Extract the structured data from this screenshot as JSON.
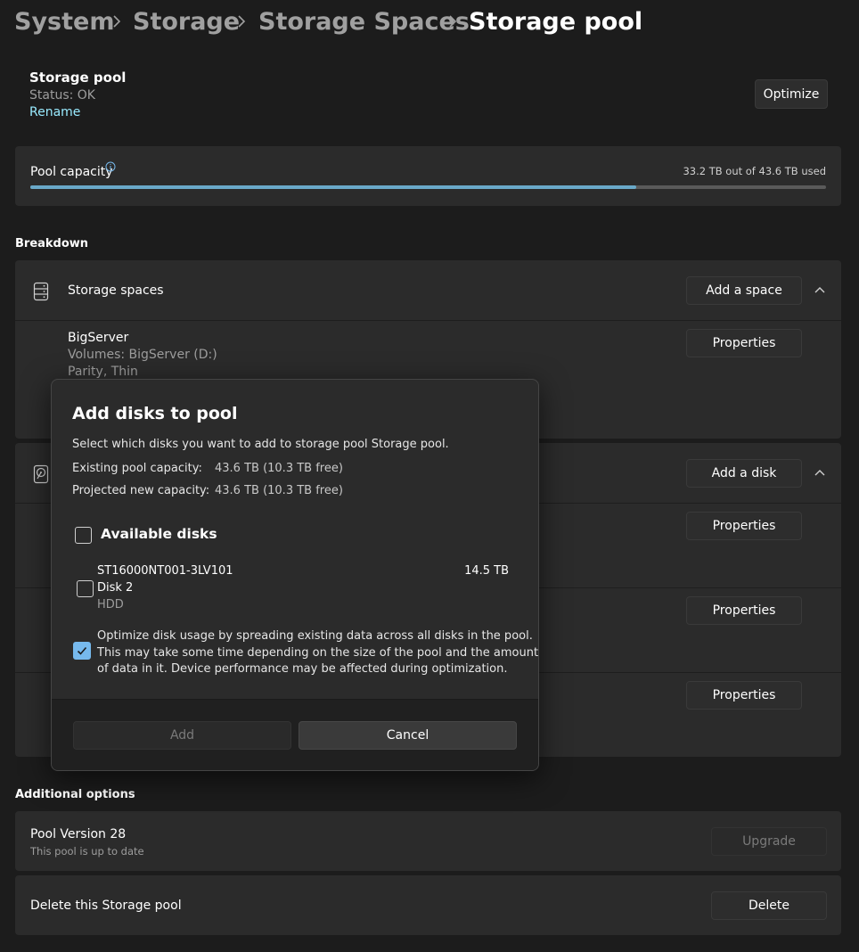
{
  "breadcrumb": {
    "items": [
      "System",
      "Storage",
      "Storage Spaces",
      "Storage pool"
    ]
  },
  "pool_header": {
    "title": "Storage pool",
    "status": "Status: OK",
    "rename": "Rename",
    "optimize_label": "Optimize"
  },
  "capacity": {
    "label": "Pool capacity",
    "usage_text": "33.2 TB out of 43.6 TB used",
    "used_fraction": 0.761
  },
  "breakdown": {
    "heading": "Breakdown",
    "storage_spaces": {
      "label": "Storage spaces",
      "add_label": "Add a space",
      "icon": "drive-stack-icon",
      "item": {
        "name": "BigServer",
        "volumes": "Volumes: BigServer (D:)",
        "type": "Parity, Thin",
        "properties_label": "Properties"
      }
    },
    "physical_disks": {
      "icon": "hard-disk-icon",
      "add_label": "Add a disk",
      "properties_labels": [
        "Properties",
        "Properties",
        "Properties"
      ]
    }
  },
  "additional": {
    "heading": "Additional options",
    "version_title": "Pool Version 28",
    "version_sub": "This pool is up to date",
    "upgrade_label": "Upgrade",
    "delete_title": "Delete this Storage pool",
    "delete_label": "Delete"
  },
  "dialog": {
    "title": "Add disks to pool",
    "description": "Select which disks you want to add to storage pool Storage pool.",
    "existing_label": "Existing pool capacity:",
    "existing_value": "43.6 TB (10.3 TB free)",
    "projected_label": "Projected new capacity:",
    "projected_value": "43.6 TB (10.3 TB free)",
    "available_label": "Available disks",
    "disk": {
      "model": "ST16000NT001-3LV101",
      "name": "Disk 2",
      "media": "HDD",
      "size": "14.5 TB"
    },
    "optimize_lines": [
      "Optimize disk usage by spreading existing data across all disks in the pool.",
      "This may take some time depending on the size of the pool and the amount",
      "of data in it. Device performance may be affected during optimization."
    ],
    "add_label": "Add",
    "cancel_label": "Cancel"
  },
  "colors": {
    "background": "#1c1c1c",
    "card": "#2b2b2b",
    "accent": "#76b9ed",
    "link": "#99ebff"
  }
}
